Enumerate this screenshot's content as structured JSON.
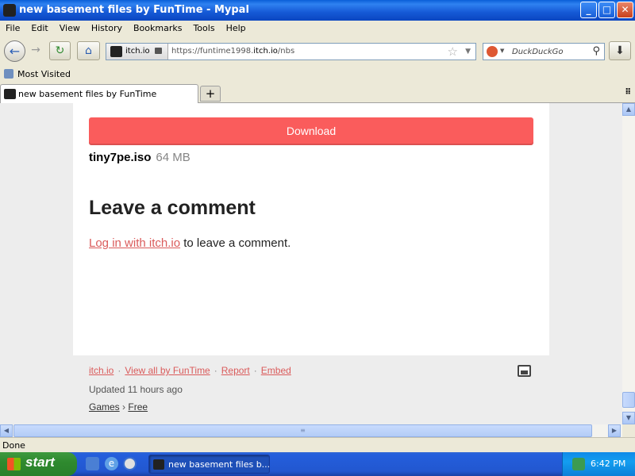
{
  "window": {
    "title": "new basement files by FunTime - Mypal",
    "controls": {
      "minimize": "_",
      "maximize": "□",
      "close": "✕"
    }
  },
  "menu": [
    "File",
    "Edit",
    "View",
    "History",
    "Bookmarks",
    "Tools",
    "Help"
  ],
  "nav": {
    "identity_label": "itch.io",
    "url_prefix": "https://funtime1998.",
    "url_domain": "itch.io",
    "url_path": "/nbs",
    "search_placeholder": "DuckDuckGo"
  },
  "bookmarks": {
    "most_visited": "Most Visited"
  },
  "tabs": [
    {
      "label": "new basement files by FunTime"
    }
  ],
  "page": {
    "download_button": "Download",
    "file_name": "tiny7pe.iso",
    "file_size": "64 MB",
    "comment_heading": "Leave a comment",
    "login_link": "Log in with itch.io",
    "login_suffix": " to leave a comment."
  },
  "footer": {
    "links": [
      "itch.io",
      "View all by FunTime",
      "Report",
      "Embed"
    ],
    "separator": "·",
    "updated": "Updated 11 hours ago",
    "crumb_category": "Games",
    "crumb_separator": "›",
    "crumb_price": "Free"
  },
  "status": {
    "text": "Done"
  },
  "taskbar": {
    "start_label": "start",
    "task_item": "new basement files b...",
    "clock": "6:42 PM"
  }
}
